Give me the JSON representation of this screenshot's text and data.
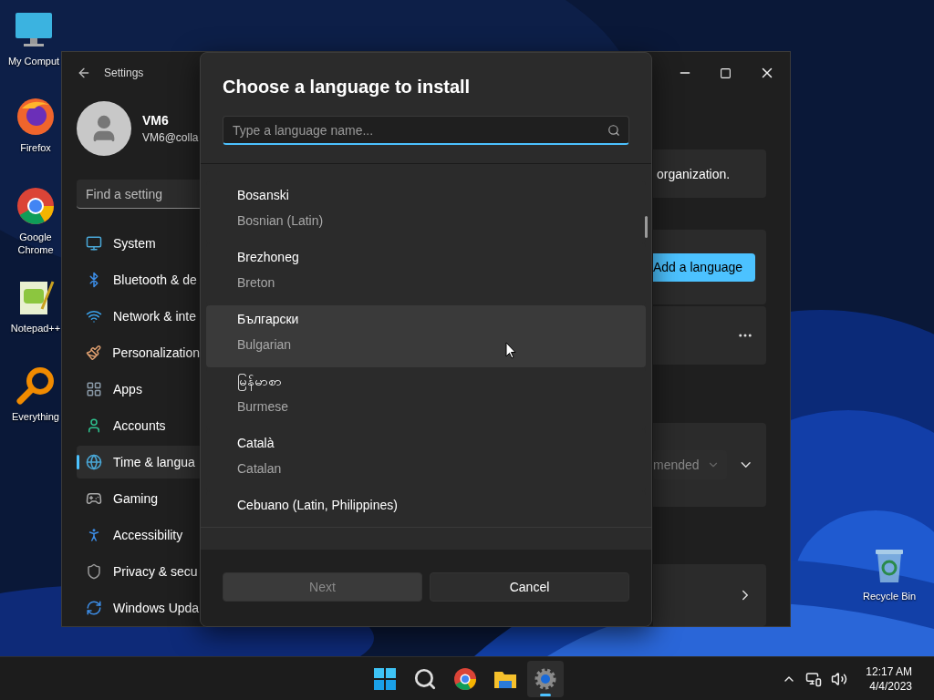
{
  "desktop_icons": [
    {
      "label": "My Comput"
    },
    {
      "label": "Firefox"
    },
    {
      "label": "Google Chrome"
    },
    {
      "label": "Notepad++"
    },
    {
      "label": "Everything"
    },
    {
      "label": "Recycle Bin"
    }
  ],
  "settings": {
    "title": "Settings",
    "user": {
      "name": "VM6",
      "email": "VM6@colla"
    },
    "search": {
      "placeholder": "Find a setting"
    },
    "nav": [
      {
        "label": "System",
        "selected": false
      },
      {
        "label": "Bluetooth & de",
        "selected": false
      },
      {
        "label": "Network & inte",
        "selected": false
      },
      {
        "label": "Personalization",
        "selected": false
      },
      {
        "label": "Apps",
        "selected": false
      },
      {
        "label": "Accounts",
        "selected": false
      },
      {
        "label": "Time & langua",
        "selected": true
      },
      {
        "label": "Gaming",
        "selected": false
      },
      {
        "label": "Accessibility",
        "selected": false
      },
      {
        "label": "Privacy & secu",
        "selected": false
      },
      {
        "label": "Windows Upda",
        "selected": false
      }
    ],
    "content": {
      "notice": "organization.",
      "add_button": "Add a language",
      "dropdown_value": "mended"
    }
  },
  "dialog": {
    "title": "Choose a language to install",
    "search": {
      "placeholder": "Type a language name..."
    },
    "languages": [
      {
        "native": "Bosanski",
        "english": "Bosnian (Latin)",
        "hovered": false
      },
      {
        "native": "Brezhoneg",
        "english": "Breton",
        "hovered": false
      },
      {
        "native": "Български",
        "english": "Bulgarian",
        "hovered": true
      },
      {
        "native": "မြန်မာစာ",
        "english": "Burmese",
        "hovered": false
      },
      {
        "native": "Català",
        "english": "Catalan",
        "hovered": false
      },
      {
        "native": "Cebuano (Latin, Philippines)",
        "hovered": false
      }
    ],
    "buttons": [
      {
        "label": "Next",
        "disabled": true
      },
      {
        "label": "Cancel",
        "disabled": false
      }
    ]
  },
  "taskbar": {
    "apps": [
      {
        "kind": "start",
        "active": false
      },
      {
        "kind": "search",
        "active": false
      },
      {
        "kind": "browser",
        "active": false
      },
      {
        "kind": "files",
        "active": false
      },
      {
        "kind": "settings",
        "active": true
      }
    ],
    "time": "12:17 AM",
    "date": "4/4/2023"
  }
}
